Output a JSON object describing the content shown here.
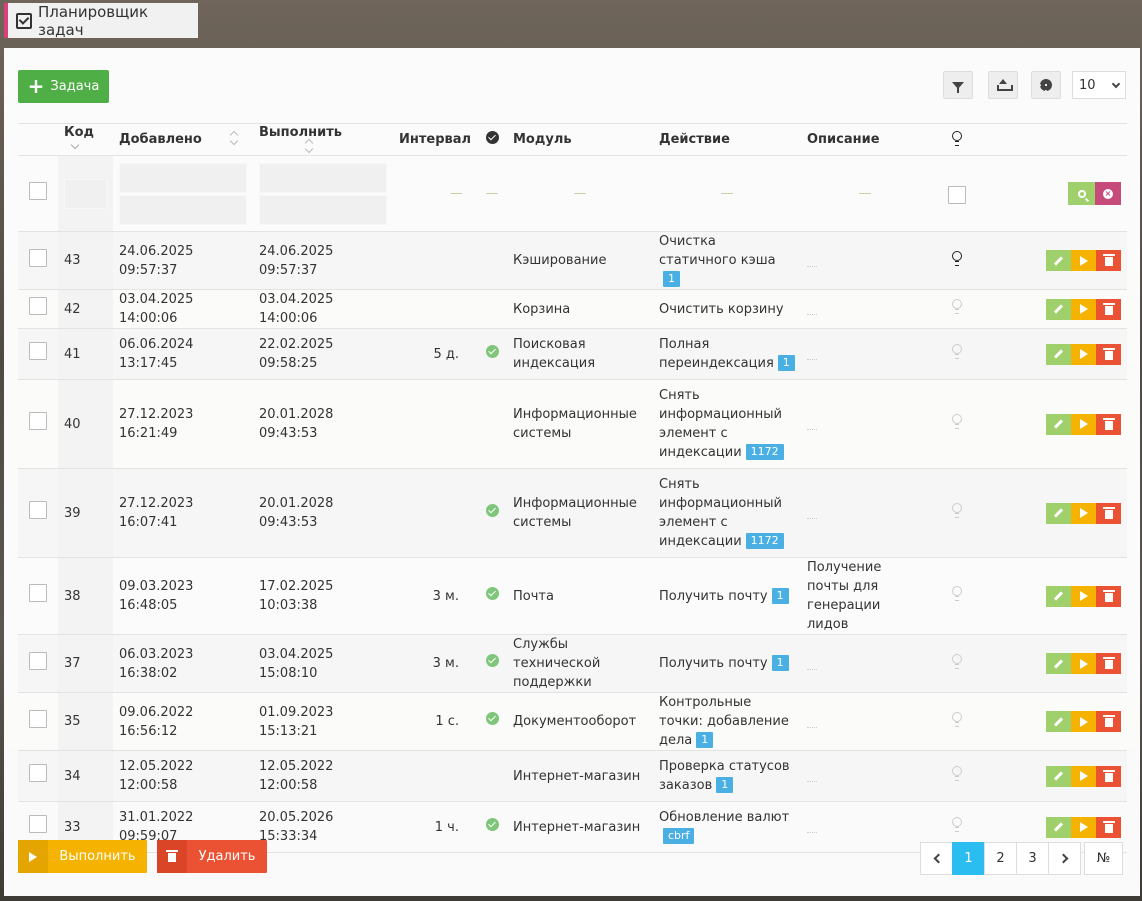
{
  "window": {
    "title": "Планировщик задач",
    "icon": "checkbox-icon"
  },
  "toolbar": {
    "add_label": "Задача",
    "page_size": "10"
  },
  "columns": {
    "code": "Код",
    "added": "Добавлено",
    "execute": "Выполнить",
    "interval": "Интервал",
    "module": "Модуль",
    "action": "Действие",
    "description": "Описание"
  },
  "filter": {
    "dash": "—"
  },
  "rows": [
    {
      "code": "43",
      "added": "24.06.2025 09:57:37",
      "execute": "24.06.2025 09:57:37",
      "interval": "",
      "active": false,
      "module": "Кэширование",
      "action": "Очистка статичного кэша",
      "tag": "1",
      "description": "",
      "indexed": true
    },
    {
      "code": "42",
      "added": "03.04.2025 14:00:06",
      "execute": "03.04.2025 14:00:06",
      "interval": "",
      "active": false,
      "module": "Корзина",
      "action": "Очистить корзину",
      "tag": "",
      "description": "",
      "indexed": false
    },
    {
      "code": "41",
      "added": "06.06.2024 13:17:45",
      "execute": "22.02.2025 09:58:25",
      "interval": "5 д.",
      "active": true,
      "module": "Поисковая индексация",
      "action": "Полная переиндексация",
      "tag": "1",
      "description": "",
      "indexed": false
    },
    {
      "code": "40",
      "added": "27.12.2023 16:21:49",
      "execute": "20.01.2028 09:43:53",
      "interval": "",
      "active": false,
      "module": "Информационные системы",
      "action": "Снять информационный элемент с индексации",
      "tag": "1172",
      "description": "",
      "indexed": false
    },
    {
      "code": "39",
      "added": "27.12.2023 16:07:41",
      "execute": "20.01.2028 09:43:53",
      "interval": "",
      "active": true,
      "module": "Информационные системы",
      "action": "Снять информационный элемент с индексации",
      "tag": "1172",
      "description": "",
      "indexed": false
    },
    {
      "code": "38",
      "added": "09.03.2023 16:48:05",
      "execute": "17.02.2025 10:03:38",
      "interval": "3 м.",
      "active": true,
      "module": "Почта",
      "action": "Получить почту",
      "tag": "1",
      "description": "Получение почты для генерации лидов",
      "indexed": false
    },
    {
      "code": "37",
      "added": "06.03.2023 16:38:02",
      "execute": "03.04.2025 15:08:10",
      "interval": "3 м.",
      "active": true,
      "module": "Службы технической поддержки",
      "action": "Получить почту",
      "tag": "1",
      "description": "",
      "indexed": false
    },
    {
      "code": "35",
      "added": "09.06.2022 16:56:12",
      "execute": "01.09.2023 15:13:21",
      "interval": "1 с.",
      "active": true,
      "module": "Документооборот",
      "action": "Контрольные точки: добавление дела",
      "tag": "1",
      "description": "",
      "indexed": false
    },
    {
      "code": "34",
      "added": "12.05.2022 12:00:58",
      "execute": "12.05.2022 12:00:58",
      "interval": "",
      "active": false,
      "module": "Интернет-магазин",
      "action": "Проверка статусов заказов",
      "tag": "1",
      "description": "",
      "indexed": false
    },
    {
      "code": "33",
      "added": "31.01.2022 09:59:07",
      "execute": "20.05.2026 15:33:34",
      "interval": "1 ч.",
      "active": true,
      "module": "Интернет-магазин",
      "action": "Обновление валют",
      "tag": "cbrf",
      "description": "",
      "indexed": false
    }
  ],
  "bottom": {
    "run_label": "Выполнить",
    "delete_label": "Удалить"
  },
  "pagination": {
    "pages": [
      "1",
      "2",
      "3"
    ],
    "current": "1",
    "goto_label": "№"
  },
  "colors": {
    "green": "#4fae45",
    "orange": "#f5b300",
    "red": "#ea5233",
    "blue": "#2bbdf0",
    "pink": "#c64b7a"
  }
}
